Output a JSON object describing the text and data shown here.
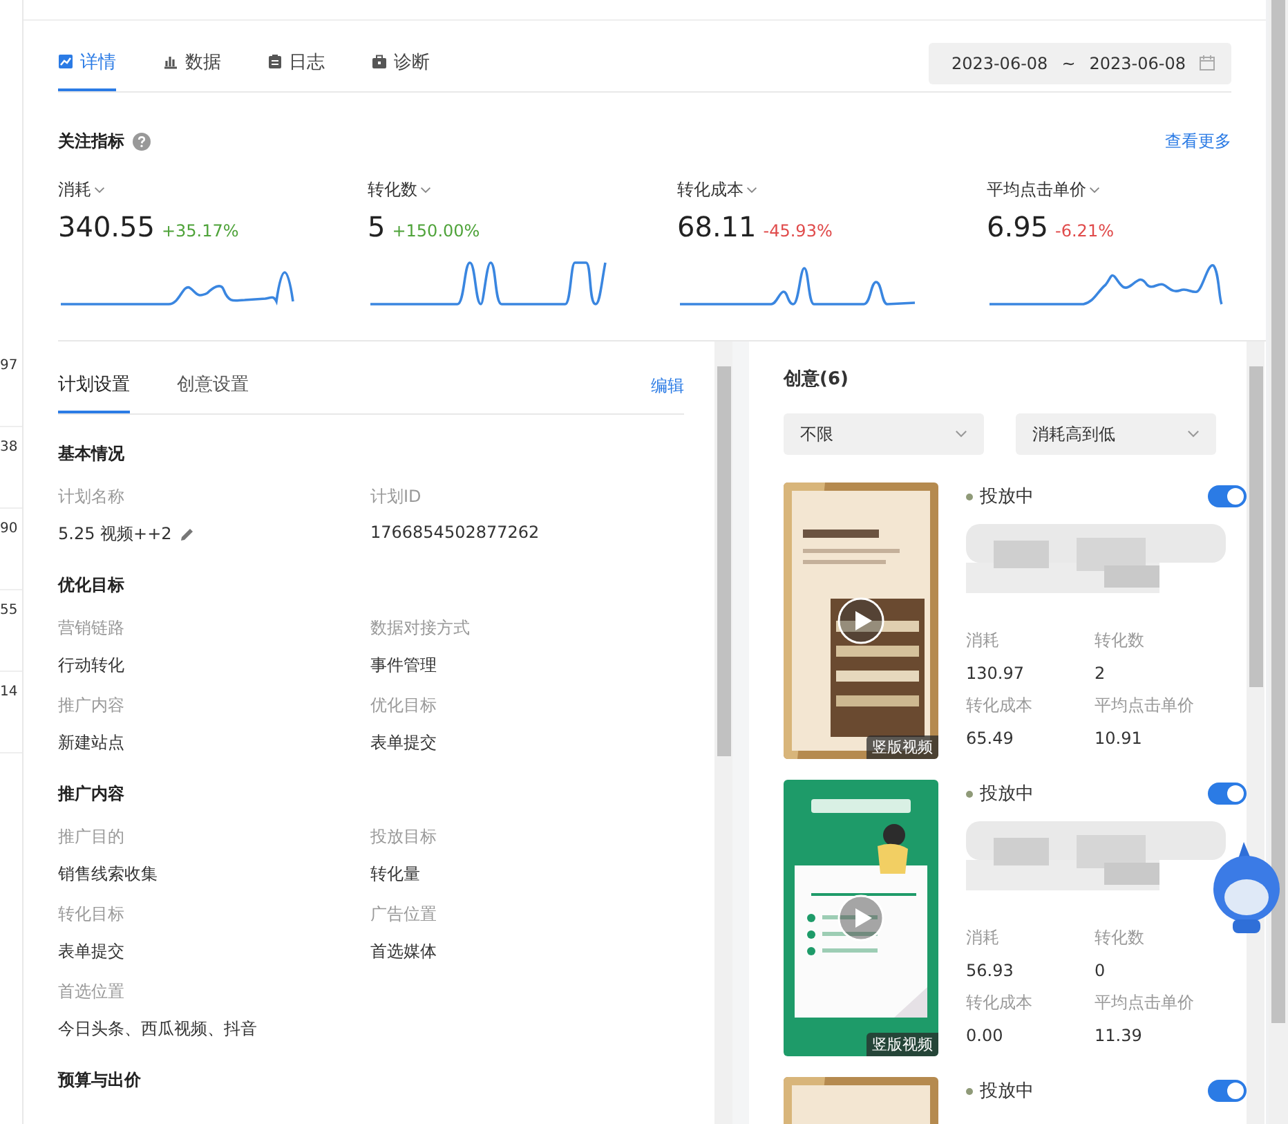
{
  "background_table": {
    "cells": [
      "97",
      "38",
      "90",
      "55",
      "14"
    ]
  },
  "tabs": [
    {
      "label": "详情",
      "selected": true
    },
    {
      "label": "数据",
      "selected": false
    },
    {
      "label": "日志",
      "selected": false
    },
    {
      "label": "诊断",
      "selected": false
    }
  ],
  "date_range": {
    "start": "2023-06-08",
    "separator": "~",
    "end": "2023-06-08"
  },
  "metrics_section": {
    "title": "关注指标",
    "more_link": "查看更多"
  },
  "metrics": [
    {
      "label": "消耗",
      "value": "340.55",
      "change": "+35.17%",
      "color": "#4fa33a"
    },
    {
      "label": "转化数",
      "value": "5",
      "change": "+150.00%",
      "color": "#4fa33a"
    },
    {
      "label": "转化成本",
      "value": "68.11",
      "change": "-45.93%",
      "color": "#e04b4b"
    },
    {
      "label": "平均点击单价",
      "value": "6.95",
      "change": "-6.21%",
      "color": "#e04b4b"
    }
  ],
  "plan_panel": {
    "tabs": [
      {
        "label": "计划设置",
        "selected": true
      },
      {
        "label": "创意设置",
        "selected": false
      }
    ],
    "edit_link": "编辑",
    "sections": [
      {
        "title": "基本情况",
        "fields": [
          {
            "label": "计划名称",
            "value": "5.25 视频++2",
            "editable": true
          },
          {
            "label": "计划ID",
            "value": "1766854502877262",
            "editable": false
          }
        ]
      },
      {
        "title": "优化目标",
        "fields": [
          {
            "label": "营销链路",
            "value": "行动转化",
            "editable": false
          },
          {
            "label": "数据对接方式",
            "value": "事件管理",
            "editable": false
          },
          {
            "label": "推广内容",
            "value": "新建站点",
            "editable": false
          },
          {
            "label": "优化目标",
            "value": "表单提交",
            "editable": false
          }
        ]
      },
      {
        "title": "推广内容",
        "fields": [
          {
            "label": "推广目的",
            "value": "销售线索收集",
            "editable": false
          },
          {
            "label": "投放目标",
            "value": "转化量",
            "editable": false
          },
          {
            "label": "转化目标",
            "value": "表单提交",
            "editable": false
          },
          {
            "label": "广告位置",
            "value": "首选媒体",
            "editable": false
          },
          {
            "label": "首选位置",
            "value": "今日头条、西瓜视频、抖音",
            "editable": false
          }
        ]
      },
      {
        "title": "预算与出价"
      }
    ]
  },
  "creatives_panel": {
    "title": "创意(6)",
    "filters": [
      {
        "value": "不限"
      },
      {
        "value": "消耗高到低"
      }
    ],
    "items": [
      {
        "status": "投放中",
        "on": true,
        "badge": "竖版视频",
        "stats": [
          {
            "label": "消耗",
            "value": "130.97"
          },
          {
            "label": "转化数",
            "value": "2"
          },
          {
            "label": "转化成本",
            "value": "65.49"
          },
          {
            "label": "平均点击单价",
            "value": "10.91"
          }
        ]
      },
      {
        "status": "投放中",
        "on": true,
        "badge": "竖版视频",
        "stats": [
          {
            "label": "消耗",
            "value": "56.93"
          },
          {
            "label": "转化数",
            "value": "0"
          },
          {
            "label": "转化成本",
            "value": "0.00"
          },
          {
            "label": "平均点击单价",
            "value": "11.39"
          }
        ]
      },
      {
        "status": "投放中",
        "on": true
      }
    ]
  }
}
